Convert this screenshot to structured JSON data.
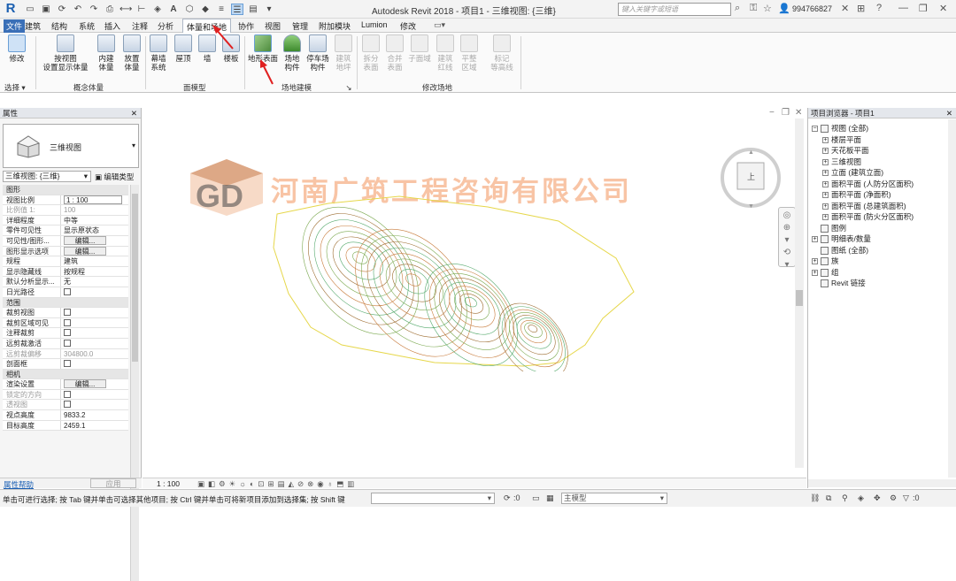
{
  "app": {
    "logo": "R",
    "title": "Autodesk Revit 2018 -",
    "project_title": "项目1 - 三维视图: {三维}",
    "search_placeholder": "键入关键字或短语",
    "user": "994766827",
    "accent_color": "#3a6fb7"
  },
  "tabs": [
    "文件",
    "建筑",
    "结构",
    "系统",
    "插入",
    "注释",
    "分析",
    "体量和场地",
    "协作",
    "视图",
    "管理",
    "附加模块",
    "Lumion",
    "修改"
  ],
  "active_tab": "体量和场地",
  "ribbon": {
    "modify": "修改",
    "select": "选择",
    "conceptual": {
      "show_mass_1": "按视图",
      "show_mass_2": "设置显示体量",
      "inplace_1": "内建",
      "inplace_2": "体量",
      "place_1": "放置",
      "place_2": "体量",
      "label": "概念体量"
    },
    "face_model": {
      "curtain_1": "幕墙",
      "curtain_2": "系统",
      "roof": "屋顶",
      "wall": "墙",
      "floor": "楼板",
      "label": "面模型"
    },
    "site_modeling": {
      "toposurface": "地形表面",
      "site_comp_1": "场地",
      "site_comp_2": "构件",
      "parking_1": "停车场",
      "parking_2": "构件",
      "pad_1": "建筑",
      "pad_2": "地坪",
      "label": "场地建模"
    },
    "modify_site": {
      "split_1": "拆分",
      "split_2": "表面",
      "merge_1": "合并",
      "merge_2": "表面",
      "subregion": "子面域",
      "property_1": "建筑",
      "property_2": "红线",
      "graded_1": "平整",
      "graded_2": "区域",
      "label_1": "标记",
      "label_2": "等高线",
      "label": "修改场地"
    }
  },
  "properties": {
    "header": "属性",
    "type_name": "三维视图",
    "instance_selector": "三维视图: {三维}",
    "edit_type": "编辑类型",
    "rows": [
      {
        "k": "图形",
        "sec": true
      },
      {
        "k": "视图比例",
        "v": "1 : 100",
        "box": true
      },
      {
        "k": "比例值 1:",
        "v": "100",
        "grey": true
      },
      {
        "k": "详细程度",
        "v": "中等"
      },
      {
        "k": "零件可见性",
        "v": "显示原状态"
      },
      {
        "k": "可见性/图形...",
        "v": "编辑...",
        "btn": true
      },
      {
        "k": "图形显示选项",
        "v": "编辑...",
        "btn": true
      },
      {
        "k": "规程",
        "v": "建筑"
      },
      {
        "k": "显示隐藏线",
        "v": "按规程"
      },
      {
        "k": "默认分析显示...",
        "v": "无"
      },
      {
        "k": "日光路径",
        "chk": true
      },
      {
        "k": "范围",
        "sec": true
      },
      {
        "k": "裁剪视图",
        "chk": true
      },
      {
        "k": "裁剪区域可见",
        "chk": true
      },
      {
        "k": "注释裁剪",
        "chk": true
      },
      {
        "k": "远剪裁激活",
        "chk": true
      },
      {
        "k": "远剪裁偏移",
        "v": "304800.0",
        "grey": true
      },
      {
        "k": "剖面框",
        "chk": true
      },
      {
        "k": "相机",
        "sec": true
      },
      {
        "k": "渲染设置",
        "v": "编辑...",
        "btn": true
      },
      {
        "k": "锁定的方向",
        "chk": true,
        "grey": true
      },
      {
        "k": "透视图",
        "chk": true,
        "grey": true
      },
      {
        "k": "视点高度",
        "v": "9833.2"
      },
      {
        "k": "目标高度",
        "v": "2459.1"
      }
    ],
    "help": "属性帮助",
    "apply": "应用"
  },
  "canvas": {
    "watermark": "河南广筑工程咨询有限公司",
    "scale": "1 : 100",
    "viewcube_face": "上"
  },
  "browser": {
    "header": "项目浏览器 - 项目1",
    "items": [
      {
        "label": "视图 (全部)",
        "lvl": 0,
        "exp": "−"
      },
      {
        "label": "楼层平面",
        "lvl": 1,
        "exp": "+"
      },
      {
        "label": "天花板平面",
        "lvl": 1,
        "exp": "+"
      },
      {
        "label": "三维视图",
        "lvl": 1,
        "exp": "+"
      },
      {
        "label": "立面 (建筑立面)",
        "lvl": 1,
        "exp": "+"
      },
      {
        "label": "面积平面 (人防分区面积)",
        "lvl": 1,
        "exp": "+"
      },
      {
        "label": "面积平面 (净面积)",
        "lvl": 1,
        "exp": "+"
      },
      {
        "label": "面积平面 (总建筑面积)",
        "lvl": 1,
        "exp": "+"
      },
      {
        "label": "面积平面 (防火分区面积)",
        "lvl": 1,
        "exp": "+"
      },
      {
        "label": "图例",
        "lvl": 0,
        "exp": ""
      },
      {
        "label": "明细表/数量",
        "lvl": 0,
        "exp": "+"
      },
      {
        "label": "图纸 (全部)",
        "lvl": 0,
        "exp": ""
      },
      {
        "label": "族",
        "lvl": 0,
        "exp": "+"
      },
      {
        "label": "组",
        "lvl": 0,
        "exp": "+"
      },
      {
        "label": "Revit 链接",
        "lvl": 0,
        "exp": ""
      }
    ]
  },
  "status": {
    "text": "单击可进行选择; 按 Tab 键并单击可选择其他项目; 按 Ctrl 键并单击可将新项目添加到选择集; 按 Shift 键",
    "zero1": ":0",
    "model": "主模型",
    "zero2": ":0"
  }
}
